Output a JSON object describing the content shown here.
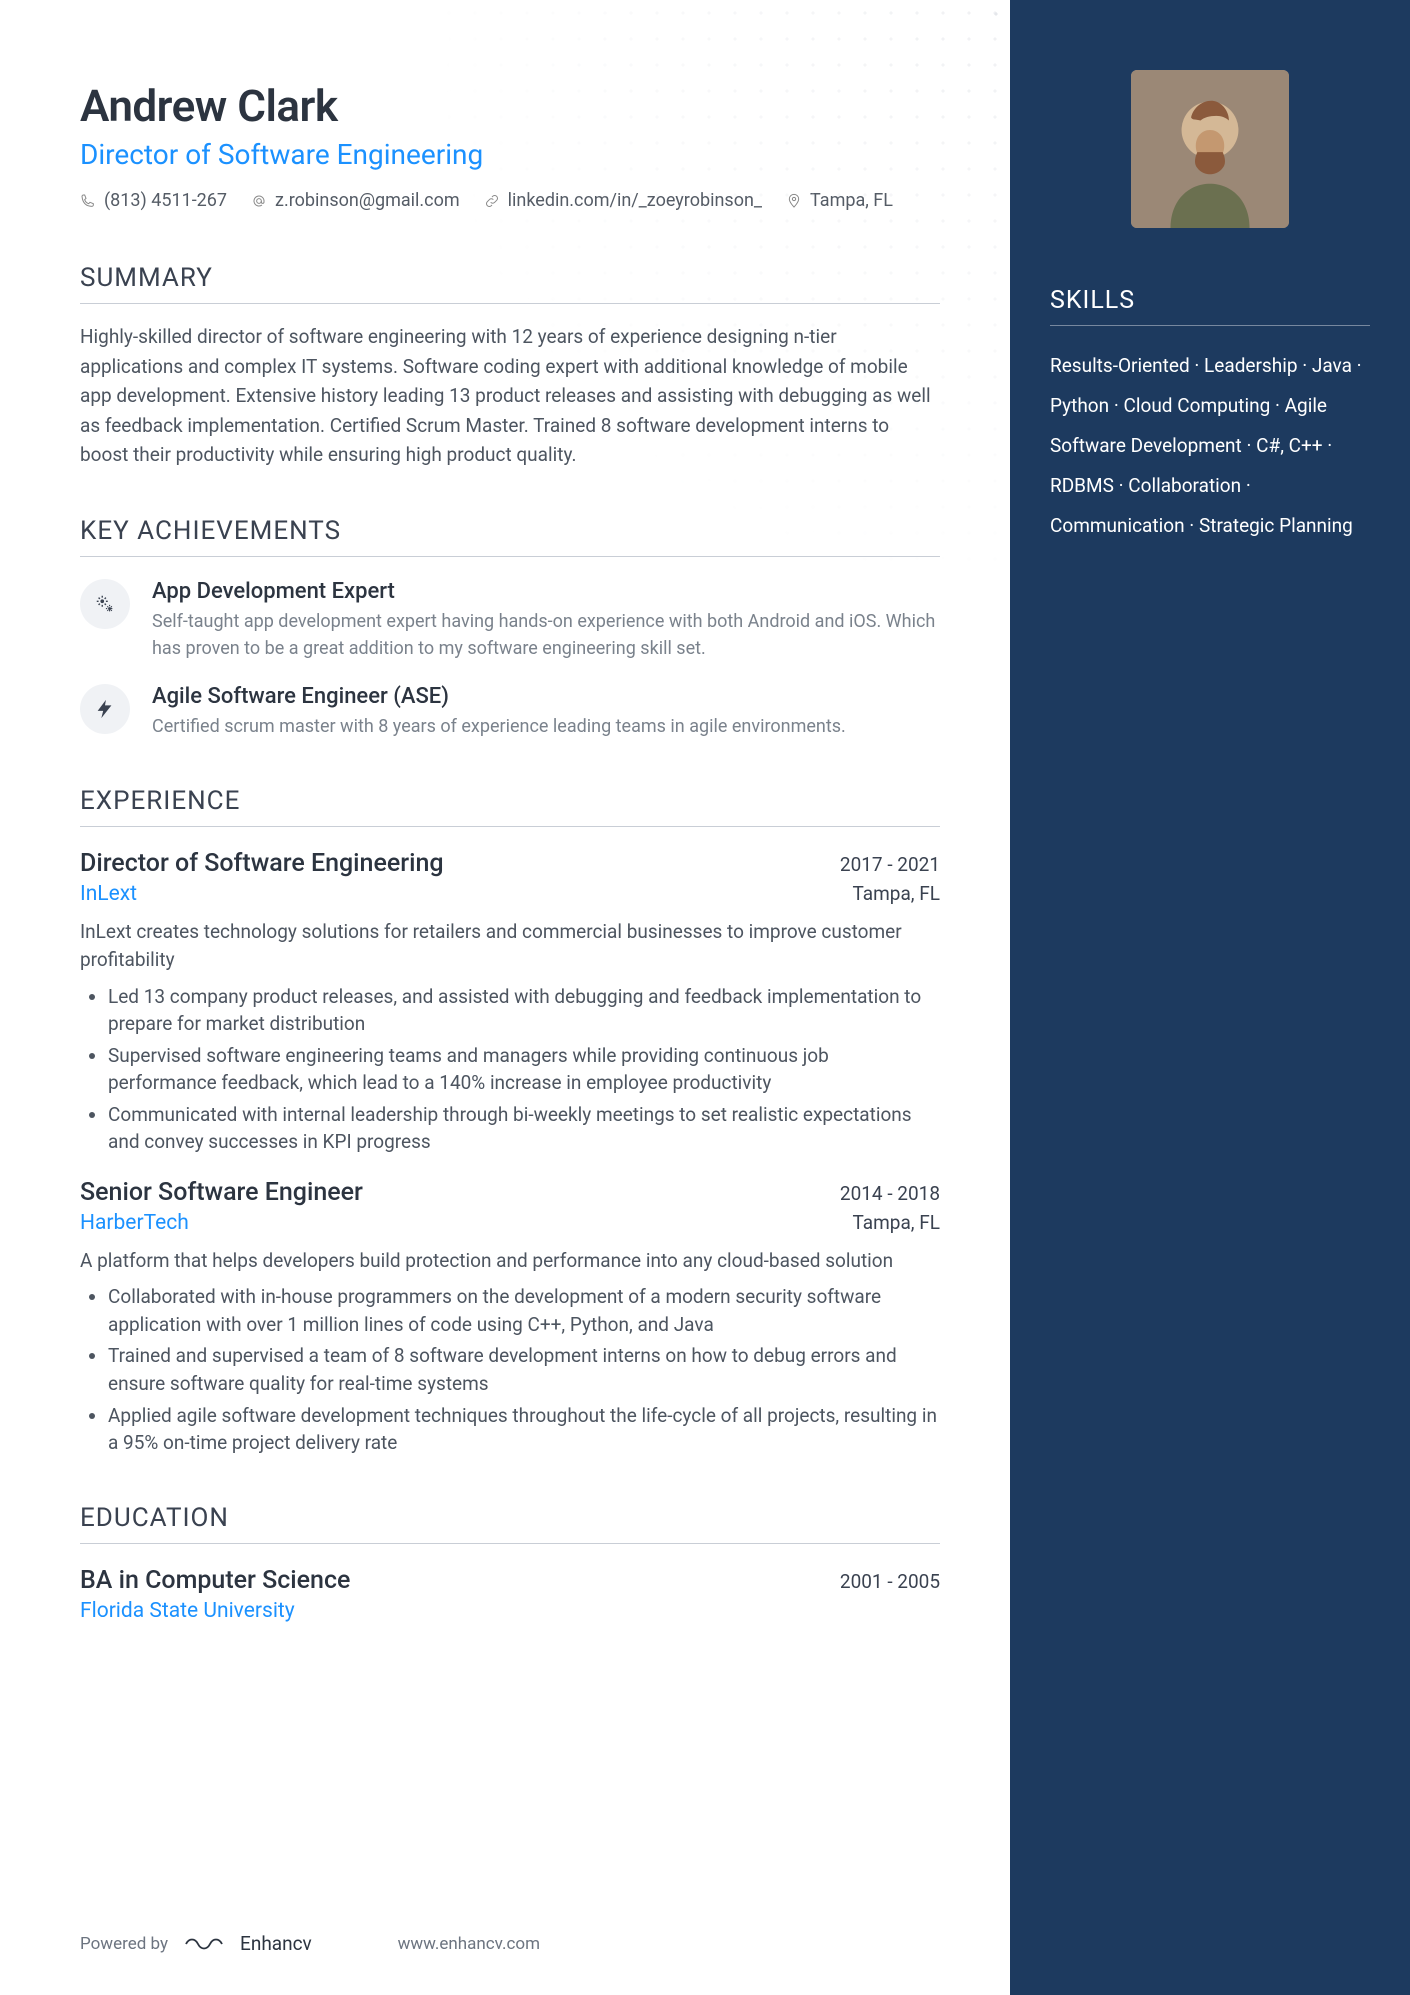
{
  "header": {
    "name": "Andrew Clark",
    "title": "Director of Software Engineering",
    "phone": "(813) 4511-267",
    "email": "z.robinson@gmail.com",
    "linkedin": "linkedin.com/in/_zoeyrobinson_",
    "location": "Tampa, FL"
  },
  "sections": {
    "summary_h": "SUMMARY",
    "summary": "Highly-skilled director of software engineering with 12 years of experience designing n-tier applications and complex IT systems. Software coding expert with additional knowledge of mobile app development. Extensive history leading 13 product releases and assisting with debugging as well as feedback implementation. Certified Scrum Master.  Trained 8 software development interns to boost their productivity while ensuring high product quality.",
    "achievements_h": "KEY ACHIEVEMENTS",
    "achievements": [
      {
        "title": "App Development Expert",
        "desc": "Self-taught app development expert having hands-on experience with both Android and iOS. Which has proven to be a great addition to my software engineering skill set."
      },
      {
        "title": "Agile Software Engineer (ASE)",
        "desc": "Certified scrum master with 8 years of experience leading teams in agile environments."
      }
    ],
    "experience_h": "EXPERIENCE",
    "experience": [
      {
        "role": "Director of Software Engineering",
        "dates": "2017 - 2021",
        "company": "InLext",
        "location": "Tampa, FL",
        "desc": "InLext creates technology solutions for retailers and commercial businesses to improve customer profitability",
        "bullets": [
          "Led 13 company product releases, and assisted with debugging and feedback implementation to prepare for market distribution",
          "Supervised software engineering teams and managers while providing continuous job performance feedback, which lead to a 140% increase in employee productivity",
          "Communicated with internal leadership through bi-weekly meetings to set realistic expectations and convey successes in KPI progress"
        ]
      },
      {
        "role": "Senior Software Engineer",
        "dates": "2014 - 2018",
        "company": "HarberTech",
        "location": "Tampa, FL",
        "desc": "A platform that helps developers build protection and performance into any cloud-based solution",
        "bullets": [
          "Collaborated with in-house programmers on the development of a modern security software application with over 1 million lines of code using C++, Python, and Java",
          "Trained and supervised a team of 8 software development interns on how to debug errors and ensure software quality for real-time systems",
          "Applied agile software development techniques throughout the life-cycle of all projects, resulting in a 95% on-time project delivery rate"
        ]
      }
    ],
    "education_h": "EDUCATION",
    "education": {
      "degree": "BA in Computer Science",
      "dates": "2001 - 2005",
      "school": "Florida State University"
    }
  },
  "side": {
    "skills_h": "SKILLS",
    "skills": "Results-Oriented · Leadership · Java · Python · Cloud Computing · Agile Software Development · C#, C++ · RDBMS · Collaboration · Communication · Strategic Planning"
  },
  "footer": {
    "powered": "Powered by",
    "brand": "Enhancv",
    "url": "www.enhancv.com"
  }
}
